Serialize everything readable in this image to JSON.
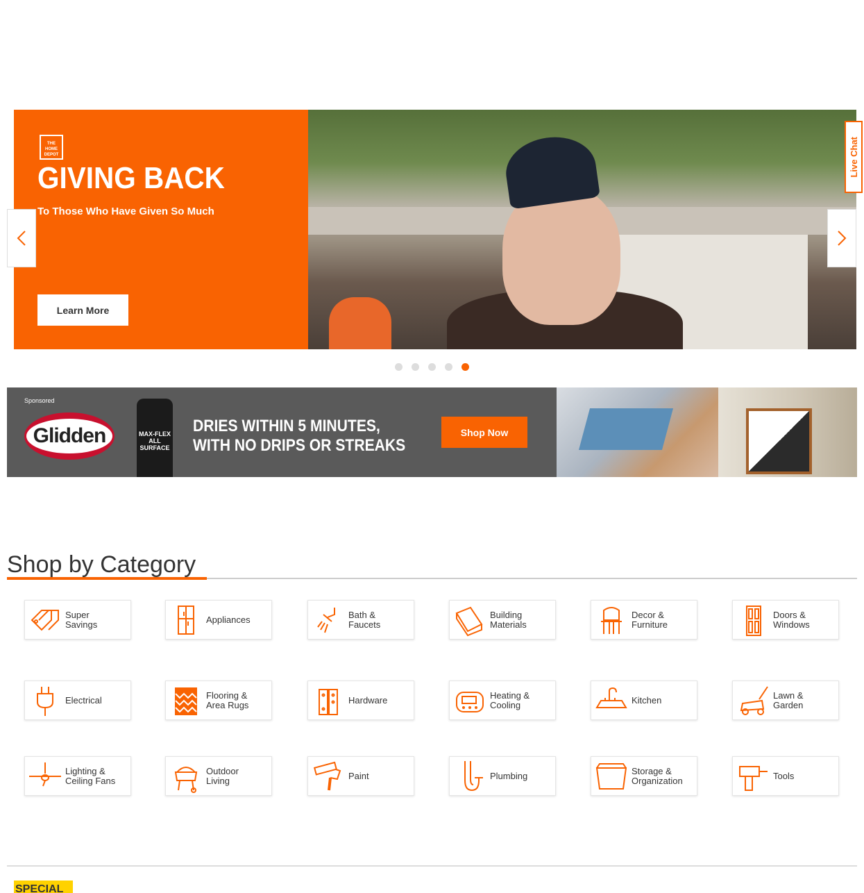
{
  "hero": {
    "brand": "THE HOME DEPOT",
    "title": "GIVING BACK",
    "subtitle": "To Those Who Have Given So Much",
    "cta": "Learn More",
    "slides": 5,
    "active_slide": 5
  },
  "live_chat": "Live Chat",
  "ad": {
    "sponsored": "Sponsored",
    "brand": "Glidden",
    "product": "MAX-FLEX ALL SURFACE",
    "headline_line1": "DRIES WITHIN 5 MINUTES,",
    "headline_line2": "WITH NO DRIPS OR STREAKS",
    "cta": "Shop Now"
  },
  "categories": {
    "title": "Shop by Category",
    "items": [
      {
        "label": "Super\nSavings",
        "icon": "tag-icon"
      },
      {
        "label": "Appliances",
        "icon": "refrigerator-icon"
      },
      {
        "label": "Bath &\nFaucets",
        "icon": "shower-icon"
      },
      {
        "label": "Building\nMaterials",
        "icon": "lumber-icon"
      },
      {
        "label": "Decor &\nFurniture",
        "icon": "chair-icon"
      },
      {
        "label": "Doors &\nWindows",
        "icon": "door-icon"
      },
      {
        "label": "Electrical",
        "icon": "plug-icon"
      },
      {
        "label": "Flooring &\nArea Rugs",
        "icon": "rug-icon"
      },
      {
        "label": "Hardware",
        "icon": "hinge-icon"
      },
      {
        "label": "Heating &\nCooling",
        "icon": "thermostat-icon"
      },
      {
        "label": "Kitchen",
        "icon": "sink-icon"
      },
      {
        "label": "Lawn &\nGarden",
        "icon": "lawnmower-icon"
      },
      {
        "label": "Lighting &\nCeiling Fans",
        "icon": "ceiling-fan-icon"
      },
      {
        "label": "Outdoor\nLiving",
        "icon": "grill-icon"
      },
      {
        "label": "Paint",
        "icon": "paint-roller-icon"
      },
      {
        "label": "Plumbing",
        "icon": "pipe-icon"
      },
      {
        "label": "Storage &\nOrganization",
        "icon": "storage-bin-icon"
      },
      {
        "label": "Tools",
        "icon": "drill-icon"
      }
    ]
  },
  "special_badge": "SPECIAL"
}
